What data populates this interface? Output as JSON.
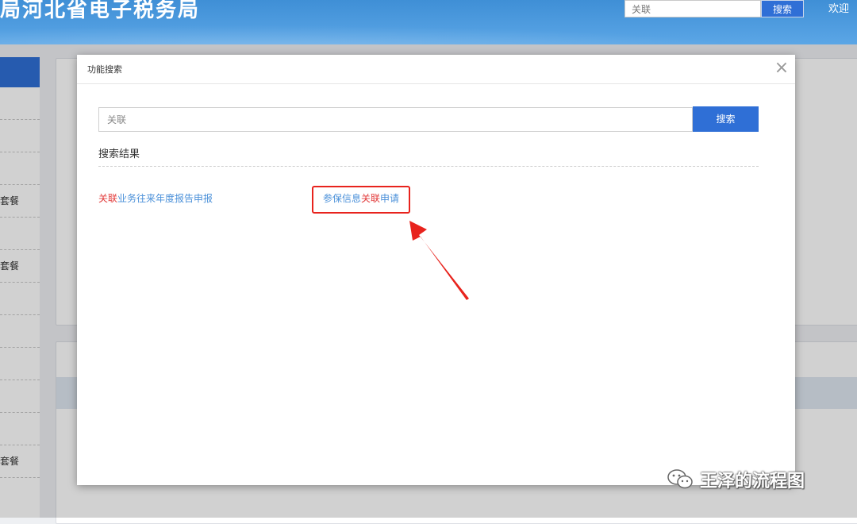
{
  "header": {
    "site_title": "局河北省电子税务局",
    "search_value": "关联",
    "search_button": "搜索",
    "welcome": "欢迎"
  },
  "sidebar": {
    "items": [
      "",
      "",
      "",
      "套餐",
      "",
      "套餐",
      "",
      "",
      "",
      "",
      "",
      "套餐"
    ]
  },
  "modal": {
    "title": "功能搜索",
    "close_symbol": "×",
    "search_value": "关联",
    "search_button": "搜索",
    "results_label": "搜索结果",
    "results": [
      {
        "keyword": "关联",
        "suffix": "业务往来年度报告申报"
      },
      {
        "prefix": "参保信息",
        "keyword": "关联",
        "suffix": "申请"
      }
    ]
  },
  "annotation": {
    "highlight_color": "#e8231d",
    "arrow_color": "#e8231d"
  },
  "watermark": {
    "text": "王泽的流程图",
    "icon": "wechat-icon"
  },
  "colors": {
    "primary": "#2f6fd6",
    "link": "#4a90d9",
    "keyword": "#e23b3b"
  }
}
